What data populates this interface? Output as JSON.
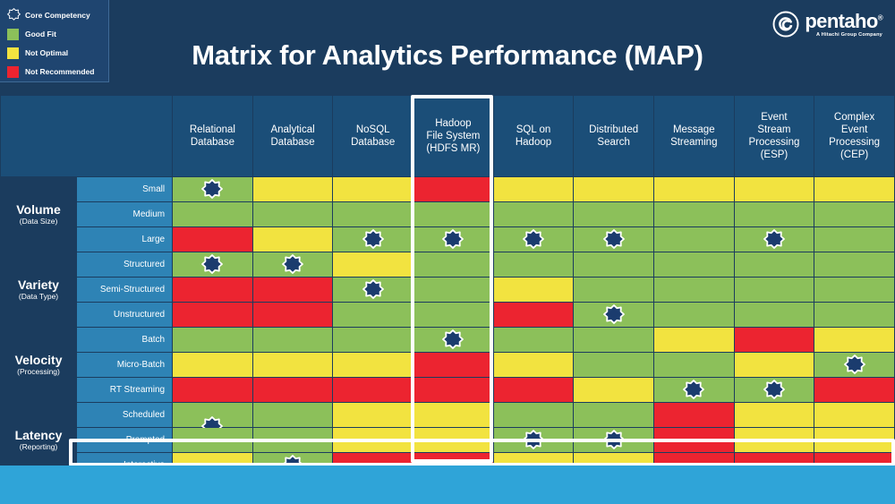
{
  "header": {
    "title": "Matrix for Analytics Performance (MAP)",
    "logo": {
      "mark": "spiral-icon",
      "word": "pentaho",
      "registered": "®",
      "tagline": "A Hitachi Group Company"
    }
  },
  "legend": {
    "items": [
      {
        "icon": "star-outline-icon",
        "label": "Core Competency",
        "color": "#ffffff",
        "type": "star"
      },
      {
        "label": "Good Fit",
        "color": "#8cc05a",
        "type": "swatch"
      },
      {
        "label": "Not Optimal",
        "color": "#f2e340",
        "type": "swatch"
      },
      {
        "label": "Not Recommended",
        "color": "#ec2430",
        "type": "swatch"
      }
    ]
  },
  "matrix": {
    "columns": [
      "Relational\nDatabase",
      "Analytical\nDatabase",
      "NoSQL\nDatabase",
      "Hadoop\nFile System\n(HDFS MR)",
      "SQL on\nHadoop",
      "Distributed\nSearch",
      "Message\nStreaming",
      "Event\nStream\nProcessing\n(ESP)",
      "Complex\nEvent\nProcessing\n(CEP)"
    ],
    "highlighted_column": "Hadoop File System (HDFS MR)",
    "highlighted_row": "Interactive",
    "groups": [
      {
        "name": "Volume",
        "sub": "(Data Size)",
        "rows": [
          {
            "label": "Small",
            "cells": [
              "green",
              "yellow",
              "yellow",
              "red",
              "yellow",
              "yellow",
              "yellow",
              "yellow",
              "yellow"
            ],
            "stars": [
              0
            ]
          },
          {
            "label": "Medium",
            "cells": [
              "green",
              "green",
              "green",
              "green",
              "green",
              "green",
              "green",
              "green",
              "green"
            ],
            "stars": []
          },
          {
            "label": "Large",
            "cells": [
              "red",
              "yellow",
              "green",
              "green",
              "green",
              "green",
              "green",
              "green",
              "green"
            ],
            "stars": [
              2,
              3,
              4,
              5,
              7
            ]
          }
        ]
      },
      {
        "name": "Variety",
        "sub": "(Data Type)",
        "rows": [
          {
            "label": "Structured",
            "cells": [
              "green",
              "green",
              "yellow",
              "green",
              "green",
              "green",
              "green",
              "green",
              "green"
            ],
            "stars": [
              0,
              1
            ]
          },
          {
            "label": "Semi-Structured",
            "cells": [
              "red",
              "red",
              "green",
              "green",
              "yellow",
              "green",
              "green",
              "green",
              "green"
            ],
            "stars": [
              2
            ]
          },
          {
            "label": "Unstructured",
            "cells": [
              "red",
              "red",
              "green",
              "green",
              "red",
              "green",
              "green",
              "green",
              "green"
            ],
            "stars": [
              5
            ]
          }
        ]
      },
      {
        "name": "Velocity",
        "sub": "(Processing)",
        "rows": [
          {
            "label": "Batch",
            "cells": [
              "green",
              "green",
              "green",
              "green",
              "green",
              "green",
              "yellow",
              "red",
              "yellow"
            ],
            "stars": [
              3
            ]
          },
          {
            "label": "Micro-Batch",
            "cells": [
              "yellow",
              "yellow",
              "yellow",
              "red",
              "yellow",
              "green",
              "green",
              "yellow",
              "green"
            ],
            "stars": [
              8
            ]
          },
          {
            "label": "RT Streaming",
            "cells": [
              "red",
              "red",
              "red",
              "red",
              "red",
              "yellow",
              "green",
              "green",
              "red"
            ],
            "stars": [
              6,
              7
            ]
          }
        ]
      },
      {
        "name": "Latency",
        "sub": "(Reporting)",
        "rows": [
          {
            "label": "Scheduled",
            "cells": [
              "green",
              "green",
              "yellow",
              "yellow",
              "green",
              "green",
              "red",
              "yellow",
              "yellow"
            ],
            "stars": [],
            "straddle_stars": [
              0
            ]
          },
          {
            "label": "Prompted",
            "cells": [
              "green",
              "green",
              "yellow",
              "yellow",
              "green",
              "green",
              "red",
              "yellow",
              "yellow"
            ],
            "stars": [
              4,
              5
            ]
          },
          {
            "label": "Interactive",
            "cells": [
              "yellow",
              "green",
              "red",
              "red",
              "yellow",
              "yellow",
              "red",
              "red",
              "red"
            ],
            "stars": [
              1
            ]
          }
        ]
      }
    ]
  }
}
